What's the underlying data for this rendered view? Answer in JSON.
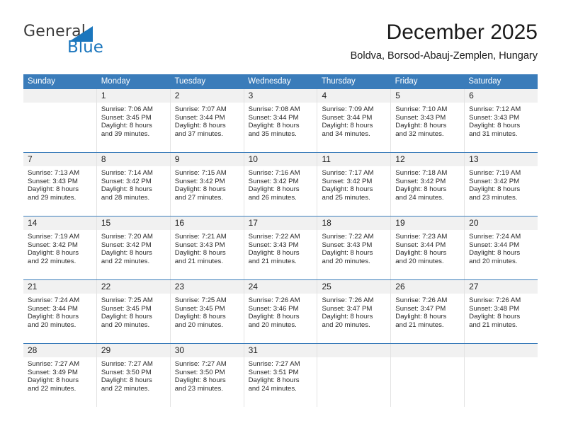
{
  "brand": {
    "name_part1": "General",
    "name_part2": "Blue",
    "accent_color": "#1b76bd",
    "logo_icon": "triangle-flag-icon"
  },
  "header": {
    "title": "December 2025",
    "subtitle": "Boldva, Borsod-Abauj-Zemplen, Hungary"
  },
  "calendar": {
    "header_bg": "#3a7cba",
    "weekdays": [
      "Sunday",
      "Monday",
      "Tuesday",
      "Wednesday",
      "Thursday",
      "Friday",
      "Saturday"
    ],
    "weeks": [
      [
        {
          "day": "",
          "sunrise": "",
          "sunset": "",
          "daylight_line1": "",
          "daylight_line2": "",
          "empty": true
        },
        {
          "day": "1",
          "sunrise": "Sunrise: 7:06 AM",
          "sunset": "Sunset: 3:45 PM",
          "daylight_line1": "Daylight: 8 hours",
          "daylight_line2": "and 39 minutes."
        },
        {
          "day": "2",
          "sunrise": "Sunrise: 7:07 AM",
          "sunset": "Sunset: 3:44 PM",
          "daylight_line1": "Daylight: 8 hours",
          "daylight_line2": "and 37 minutes."
        },
        {
          "day": "3",
          "sunrise": "Sunrise: 7:08 AM",
          "sunset": "Sunset: 3:44 PM",
          "daylight_line1": "Daylight: 8 hours",
          "daylight_line2": "and 35 minutes."
        },
        {
          "day": "4",
          "sunrise": "Sunrise: 7:09 AM",
          "sunset": "Sunset: 3:44 PM",
          "daylight_line1": "Daylight: 8 hours",
          "daylight_line2": "and 34 minutes."
        },
        {
          "day": "5",
          "sunrise": "Sunrise: 7:10 AM",
          "sunset": "Sunset: 3:43 PM",
          "daylight_line1": "Daylight: 8 hours",
          "daylight_line2": "and 32 minutes."
        },
        {
          "day": "6",
          "sunrise": "Sunrise: 7:12 AM",
          "sunset": "Sunset: 3:43 PM",
          "daylight_line1": "Daylight: 8 hours",
          "daylight_line2": "and 31 minutes."
        }
      ],
      [
        {
          "day": "7",
          "sunrise": "Sunrise: 7:13 AM",
          "sunset": "Sunset: 3:43 PM",
          "daylight_line1": "Daylight: 8 hours",
          "daylight_line2": "and 29 minutes."
        },
        {
          "day": "8",
          "sunrise": "Sunrise: 7:14 AM",
          "sunset": "Sunset: 3:42 PM",
          "daylight_line1": "Daylight: 8 hours",
          "daylight_line2": "and 28 minutes."
        },
        {
          "day": "9",
          "sunrise": "Sunrise: 7:15 AM",
          "sunset": "Sunset: 3:42 PM",
          "daylight_line1": "Daylight: 8 hours",
          "daylight_line2": "and 27 minutes."
        },
        {
          "day": "10",
          "sunrise": "Sunrise: 7:16 AM",
          "sunset": "Sunset: 3:42 PM",
          "daylight_line1": "Daylight: 8 hours",
          "daylight_line2": "and 26 minutes."
        },
        {
          "day": "11",
          "sunrise": "Sunrise: 7:17 AM",
          "sunset": "Sunset: 3:42 PM",
          "daylight_line1": "Daylight: 8 hours",
          "daylight_line2": "and 25 minutes."
        },
        {
          "day": "12",
          "sunrise": "Sunrise: 7:18 AM",
          "sunset": "Sunset: 3:42 PM",
          "daylight_line1": "Daylight: 8 hours",
          "daylight_line2": "and 24 minutes."
        },
        {
          "day": "13",
          "sunrise": "Sunrise: 7:19 AM",
          "sunset": "Sunset: 3:42 PM",
          "daylight_line1": "Daylight: 8 hours",
          "daylight_line2": "and 23 minutes."
        }
      ],
      [
        {
          "day": "14",
          "sunrise": "Sunrise: 7:19 AM",
          "sunset": "Sunset: 3:42 PM",
          "daylight_line1": "Daylight: 8 hours",
          "daylight_line2": "and 22 minutes."
        },
        {
          "day": "15",
          "sunrise": "Sunrise: 7:20 AM",
          "sunset": "Sunset: 3:42 PM",
          "daylight_line1": "Daylight: 8 hours",
          "daylight_line2": "and 22 minutes."
        },
        {
          "day": "16",
          "sunrise": "Sunrise: 7:21 AM",
          "sunset": "Sunset: 3:43 PM",
          "daylight_line1": "Daylight: 8 hours",
          "daylight_line2": "and 21 minutes."
        },
        {
          "day": "17",
          "sunrise": "Sunrise: 7:22 AM",
          "sunset": "Sunset: 3:43 PM",
          "daylight_line1": "Daylight: 8 hours",
          "daylight_line2": "and 21 minutes."
        },
        {
          "day": "18",
          "sunrise": "Sunrise: 7:22 AM",
          "sunset": "Sunset: 3:43 PM",
          "daylight_line1": "Daylight: 8 hours",
          "daylight_line2": "and 20 minutes."
        },
        {
          "day": "19",
          "sunrise": "Sunrise: 7:23 AM",
          "sunset": "Sunset: 3:44 PM",
          "daylight_line1": "Daylight: 8 hours",
          "daylight_line2": "and 20 minutes."
        },
        {
          "day": "20",
          "sunrise": "Sunrise: 7:24 AM",
          "sunset": "Sunset: 3:44 PM",
          "daylight_line1": "Daylight: 8 hours",
          "daylight_line2": "and 20 minutes."
        }
      ],
      [
        {
          "day": "21",
          "sunrise": "Sunrise: 7:24 AM",
          "sunset": "Sunset: 3:44 PM",
          "daylight_line1": "Daylight: 8 hours",
          "daylight_line2": "and 20 minutes."
        },
        {
          "day": "22",
          "sunrise": "Sunrise: 7:25 AM",
          "sunset": "Sunset: 3:45 PM",
          "daylight_line1": "Daylight: 8 hours",
          "daylight_line2": "and 20 minutes."
        },
        {
          "day": "23",
          "sunrise": "Sunrise: 7:25 AM",
          "sunset": "Sunset: 3:45 PM",
          "daylight_line1": "Daylight: 8 hours",
          "daylight_line2": "and 20 minutes."
        },
        {
          "day": "24",
          "sunrise": "Sunrise: 7:26 AM",
          "sunset": "Sunset: 3:46 PM",
          "daylight_line1": "Daylight: 8 hours",
          "daylight_line2": "and 20 minutes."
        },
        {
          "day": "25",
          "sunrise": "Sunrise: 7:26 AM",
          "sunset": "Sunset: 3:47 PM",
          "daylight_line1": "Daylight: 8 hours",
          "daylight_line2": "and 20 minutes."
        },
        {
          "day": "26",
          "sunrise": "Sunrise: 7:26 AM",
          "sunset": "Sunset: 3:47 PM",
          "daylight_line1": "Daylight: 8 hours",
          "daylight_line2": "and 21 minutes."
        },
        {
          "day": "27",
          "sunrise": "Sunrise: 7:26 AM",
          "sunset": "Sunset: 3:48 PM",
          "daylight_line1": "Daylight: 8 hours",
          "daylight_line2": "and 21 minutes."
        }
      ],
      [
        {
          "day": "28",
          "sunrise": "Sunrise: 7:27 AM",
          "sunset": "Sunset: 3:49 PM",
          "daylight_line1": "Daylight: 8 hours",
          "daylight_line2": "and 22 minutes."
        },
        {
          "day": "29",
          "sunrise": "Sunrise: 7:27 AM",
          "sunset": "Sunset: 3:50 PM",
          "daylight_line1": "Daylight: 8 hours",
          "daylight_line2": "and 22 minutes."
        },
        {
          "day": "30",
          "sunrise": "Sunrise: 7:27 AM",
          "sunset": "Sunset: 3:50 PM",
          "daylight_line1": "Daylight: 8 hours",
          "daylight_line2": "and 23 minutes."
        },
        {
          "day": "31",
          "sunrise": "Sunrise: 7:27 AM",
          "sunset": "Sunset: 3:51 PM",
          "daylight_line1": "Daylight: 8 hours",
          "daylight_line2": "and 24 minutes."
        },
        {
          "day": "",
          "sunrise": "",
          "sunset": "",
          "daylight_line1": "",
          "daylight_line2": "",
          "empty": true
        },
        {
          "day": "",
          "sunrise": "",
          "sunset": "",
          "daylight_line1": "",
          "daylight_line2": "",
          "empty": true
        },
        {
          "day": "",
          "sunrise": "",
          "sunset": "",
          "daylight_line1": "",
          "daylight_line2": "",
          "empty": true
        }
      ]
    ]
  }
}
